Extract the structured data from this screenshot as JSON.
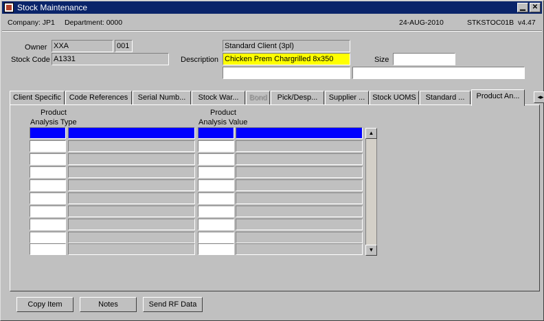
{
  "window": {
    "title": "Stock Maintenance"
  },
  "info": {
    "company": "Company:  JP1",
    "department": "Department:  0000",
    "date": "24-AUG-2010",
    "form_code": "STKSTOC01B",
    "version": "v4.47"
  },
  "form": {
    "owner_label": "Owner",
    "owner_value": "XXA",
    "owner_sub": "001",
    "stock_code_label": "Stock Code",
    "stock_code_value": "A1331",
    "client_name": "Standard Client (3pl)",
    "description_label": "Description",
    "description_value": "Chicken Prem Chargrilled 8x350",
    "size_label": "Size",
    "size_value": "",
    "extra1": "",
    "extra2": ""
  },
  "tabs": [
    {
      "label": "Client Specific"
    },
    {
      "label": "Code References"
    },
    {
      "label": "Serial Numb..."
    },
    {
      "label": "Stock War..."
    },
    {
      "label": "Bond"
    },
    {
      "label": "Pick/Desp..."
    },
    {
      "label": "Supplier ..."
    },
    {
      "label": "Stock UOMS"
    },
    {
      "label": "Standard ..."
    },
    {
      "label": "Product An..."
    }
  ],
  "grid": {
    "col1_header": "Product\nAnalysis Type",
    "col1_line1": "Product",
    "col1_line2": "Analysis Type",
    "col2_line1": "Product",
    "col2_line2": "Analysis Value",
    "rows": 10
  },
  "buttons": {
    "copy_item": "Copy Item",
    "notes": "Notes",
    "send_rf": "Send RF Data"
  },
  "icons": {
    "minimize": "minimize-icon",
    "close": "close-icon",
    "scroll_up": "scroll-up-icon",
    "scroll_down": "scroll-down-icon",
    "tab_scroll": "tab-scroll-icon"
  }
}
